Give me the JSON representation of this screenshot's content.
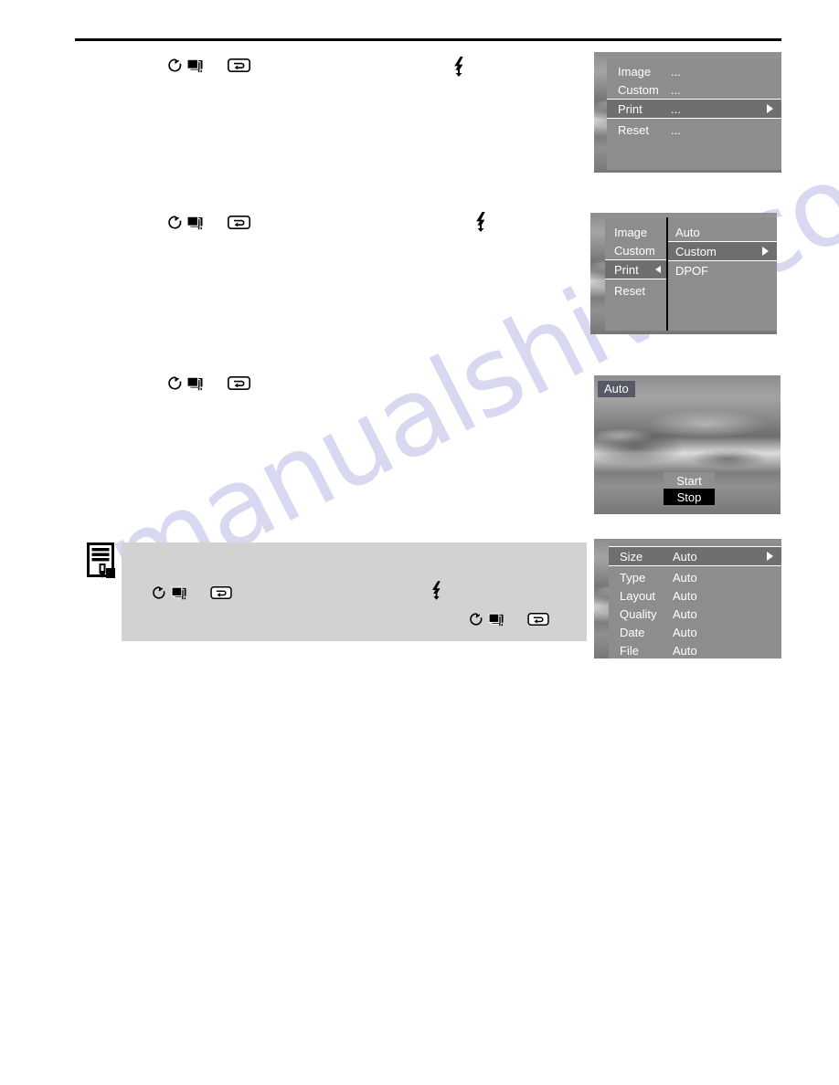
{
  "page": {
    "watermark_text": "manualshive.com",
    "background_color": "#ffffff",
    "rule_color": "#000000"
  },
  "icon_rows": [
    {
      "name": "step-1-icons",
      "icons": [
        "self-timer-icon",
        "continuous-shooting-icon",
        "menu-button-icon"
      ],
      "flash_icon": "flash-icon"
    },
    {
      "name": "step-2-icons",
      "icons": [
        "self-timer-icon",
        "continuous-shooting-icon",
        "menu-button-icon"
      ],
      "flash_icon": "flash-icon"
    },
    {
      "name": "step-3-icons",
      "icons": [
        "self-timer-icon",
        "continuous-shooting-icon",
        "menu-button-icon"
      ],
      "flash_icon": null
    }
  ],
  "note": {
    "icon": "memo-note-icon",
    "background_color": "#d2d2d2",
    "icons_line_1": [
      "self-timer-icon",
      "continuous-shooting-icon",
      "menu-button-icon"
    ],
    "flash_icon": "flash-icon",
    "icons_line_2": [
      "self-timer-icon",
      "continuous-shooting-icon",
      "menu-button-icon"
    ]
  },
  "screens": {
    "setup_menu": {
      "name": "setup-menu-screen",
      "rows": [
        {
          "label": "Image",
          "value": "...",
          "selected": false,
          "arrow": null
        },
        {
          "label": "Custom",
          "value": "...",
          "selected": false,
          "arrow": null
        },
        {
          "label": "Print",
          "value": "...",
          "selected": true,
          "arrow": "right"
        },
        {
          "label": "Reset",
          "value": "...",
          "selected": false,
          "arrow": null
        }
      ]
    },
    "print_submenu": {
      "name": "print-submenu-screen",
      "left_rows": [
        {
          "label": "Image",
          "selected": false,
          "arrow": null
        },
        {
          "label": "Custom",
          "selected": false,
          "arrow": null
        },
        {
          "label": "Print",
          "selected": true,
          "arrow": "left"
        },
        {
          "label": "Reset",
          "selected": false,
          "arrow": null
        }
      ],
      "right_rows": [
        {
          "label": "Auto",
          "selected": false,
          "arrow": null
        },
        {
          "label": "Custom",
          "selected": true,
          "arrow": "right"
        },
        {
          "label": "DPOF",
          "selected": false,
          "arrow": null
        }
      ]
    },
    "print_preview": {
      "name": "print-preview-screen",
      "badge": "Auto",
      "buttons": [
        {
          "label": "Start",
          "selected": false
        },
        {
          "label": "Stop",
          "selected": true
        }
      ]
    },
    "print_settings": {
      "name": "print-settings-screen",
      "rows": [
        {
          "label": "Size",
          "value": "Auto",
          "selected": true,
          "arrow": "right"
        },
        {
          "label": "Type",
          "value": "Auto",
          "selected": false,
          "arrow": null
        },
        {
          "label": "Layout",
          "value": "Auto",
          "selected": false,
          "arrow": null
        },
        {
          "label": "Quality",
          "value": "Auto",
          "selected": false,
          "arrow": null
        },
        {
          "label": "Date",
          "value": "Auto",
          "selected": false,
          "arrow": null
        },
        {
          "label": "File",
          "value": "Auto",
          "selected": false,
          "arrow": null
        }
      ]
    }
  },
  "colors": {
    "menu_bg": "#8d8d8d",
    "menu_selected_bg": "#6f6f6f",
    "menu_text": "#ffffff",
    "badge_bg": "#555a66",
    "button_active_bg": "#000000",
    "button_normal_bg": "#8f8f8f",
    "note_bg": "#d2d2d2",
    "watermark_color": "#b9b9e4"
  }
}
